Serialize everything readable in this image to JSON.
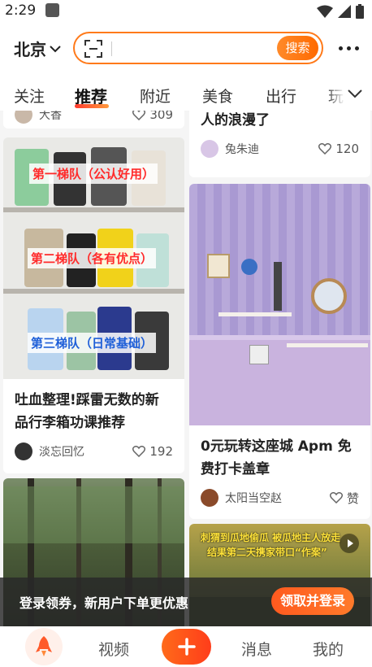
{
  "status": {
    "time": "2:29"
  },
  "header": {
    "city": "北京",
    "search_button": "搜索",
    "search_placeholder": ""
  },
  "tabs": [
    {
      "label": "关注"
    },
    {
      "label": "推荐",
      "active": true
    },
    {
      "label": "附近"
    },
    {
      "label": "美食"
    },
    {
      "label": "出行"
    },
    {
      "label": "玩"
    }
  ],
  "feed": {
    "left": [
      {
        "author": "大香",
        "likes": "309"
      },
      {
        "image_overlays": [
          "第一梯队（公认好用）",
          "第二梯队（各有优点）",
          "第三梯队（日常基础）"
        ],
        "title_line1": "吐血整理!踩雷无数的新",
        "title_line2": "品行李箱功课推荐",
        "author": "淡忘回忆",
        "likes": "192"
      }
    ],
    "right": [
      {
        "title": "人的浪漫了",
        "author": "兔朱迪",
        "likes": "120"
      },
      {
        "title_line1": "0元玩转这座城 Apm 免",
        "title_line2": "费打卡盖章",
        "author": "太阳当空赵",
        "likes": "赞"
      },
      {
        "image_overlay_line1": "刺猬到瓜地偷瓜 被瓜地主人放走",
        "image_overlay_line2": "结果第二天携家带口“作案”"
      }
    ]
  },
  "banner": {
    "text": "登录领券，新用户下单更优惠",
    "button": "领取并登录"
  },
  "bottom_nav": {
    "video": "视频",
    "messages": "消息",
    "me": "我的"
  },
  "colors": {
    "accent": "#ff6a00",
    "accent_red": "#ff3d1a"
  }
}
